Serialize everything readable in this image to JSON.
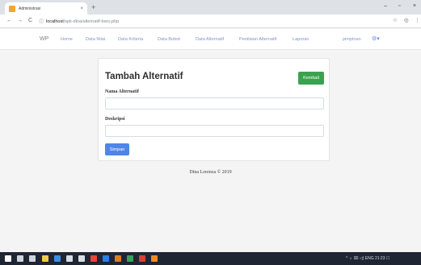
{
  "browser": {
    "tab_title": "Administrasi",
    "tab_close": "×",
    "new_tab": "+",
    "window_controls": [
      "–",
      "▫",
      "×"
    ],
    "nav": {
      "back": "←",
      "forward": "→",
      "reload": "C"
    },
    "url_host": "localhost",
    "url_path": "/spk-dina/alternatif-baru.php",
    "info_icon": "ⓘ",
    "right_icons": [
      "☆",
      "◎",
      "⋮"
    ]
  },
  "navbar": {
    "brand": "WP",
    "links": [
      "Home",
      "Data Nilai",
      "Data Kriteria",
      "Data Bobot",
      "Data Alternatif",
      "Penilaian Alternatif",
      "Laporan"
    ],
    "user": "pimpinan",
    "settings_icon": "⚙▾"
  },
  "form": {
    "title": "Tambah Alternatif",
    "back_button": "Kembali",
    "field1_label": "Nama Alternatif",
    "field1_value": "",
    "field2_label": "Deskripsi",
    "field2_value": "",
    "save_button": "Simpan"
  },
  "footer": {
    "text": "Dina Lorenza © 2019"
  },
  "taskbar": {
    "icons": [
      {
        "name": "windows-start-icon",
        "color": "#ffffff"
      },
      {
        "name": "search-icon",
        "color": "#cfd5df"
      },
      {
        "name": "task-view-icon",
        "color": "#cfd5df"
      },
      {
        "name": "file-explorer-icon",
        "color": "#f2c94c"
      },
      {
        "name": "edge-icon",
        "color": "#3d8ee6"
      },
      {
        "name": "store-icon",
        "color": "#d9dde4"
      },
      {
        "name": "mail-icon",
        "color": "#d9dde4"
      },
      {
        "name": "chrome-icon",
        "color": "#e8453c"
      },
      {
        "name": "app-blue-icon",
        "color": "#2b7de9"
      },
      {
        "name": "app-orange-icon",
        "color": "#e07b24"
      },
      {
        "name": "app-green-icon",
        "color": "#37a35a"
      },
      {
        "name": "app-red-icon",
        "color": "#d7422f"
      },
      {
        "name": "sublime-icon",
        "color": "#f08a24"
      }
    ],
    "tray_text": "^ ☼ ⌧ ◁) ENG 21:23 ☐"
  },
  "colors": {
    "accent_green": "#3aa24f",
    "accent_blue": "#4e86e8",
    "nav_link": "#7f93d8"
  }
}
